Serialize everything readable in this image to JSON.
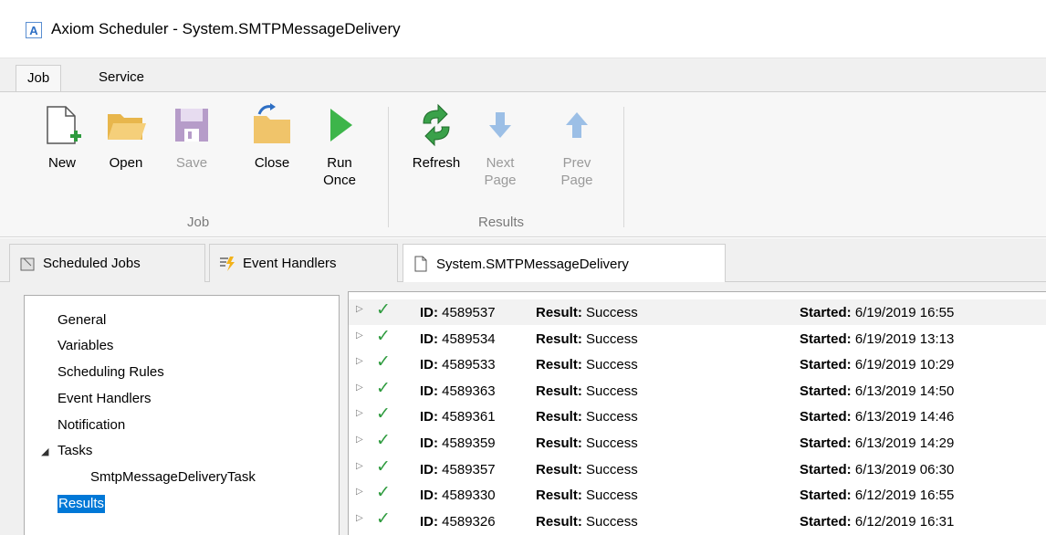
{
  "window": {
    "app_icon": "A",
    "title": "Axiom Scheduler - System.SMTPMessageDelivery"
  },
  "ribbon_tabs": [
    "Job",
    "Service"
  ],
  "ribbon": {
    "buttons": [
      {
        "label": "New",
        "icon": "new-document-icon"
      },
      {
        "label": "Open",
        "icon": "open-folder-icon"
      },
      {
        "label": "Save",
        "icon": "save-disk-icon"
      },
      {
        "label": "Close",
        "icon": "close-folder-icon"
      },
      {
        "label": "Run\nOnce",
        "icon": "play-icon"
      },
      {
        "label": "Refresh",
        "icon": "refresh-icon"
      },
      {
        "label": "Next\nPage",
        "icon": "arrow-down-icon"
      },
      {
        "label": "Prev\nPage",
        "icon": "arrow-up-icon"
      }
    ],
    "groups": [
      "Job",
      "Results"
    ]
  },
  "doc_tabs": [
    "Scheduled Jobs",
    "Event Handlers",
    "System.SMTPMessageDelivery"
  ],
  "nav": {
    "items": [
      "General",
      "Variables",
      "Scheduling Rules",
      "Event Handlers",
      "Notification",
      "Tasks",
      "SmtpMessageDeliveryTask",
      "Results"
    ],
    "expander": "◢"
  },
  "results": {
    "id_label": "ID:",
    "result_label": "Result:",
    "started_label": "Started:",
    "rows": [
      {
        "id": "4589537",
        "result": "Success",
        "started": "6/19/2019 16:55"
      },
      {
        "id": "4589534",
        "result": "Success",
        "started": "6/19/2019 13:13"
      },
      {
        "id": "4589533",
        "result": "Success",
        "started": "6/19/2019 10:29"
      },
      {
        "id": "4589363",
        "result": "Success",
        "started": "6/13/2019 14:50"
      },
      {
        "id": "4589361",
        "result": "Success",
        "started": "6/13/2019 14:46"
      },
      {
        "id": "4589359",
        "result": "Success",
        "started": "6/13/2019 14:29"
      },
      {
        "id": "4589357",
        "result": "Success",
        "started": "6/13/2019 06:30"
      },
      {
        "id": "4589330",
        "result": "Success",
        "started": "6/12/2019 16:55"
      },
      {
        "id": "4589326",
        "result": "Success",
        "started": "6/12/2019 16:31"
      }
    ]
  }
}
